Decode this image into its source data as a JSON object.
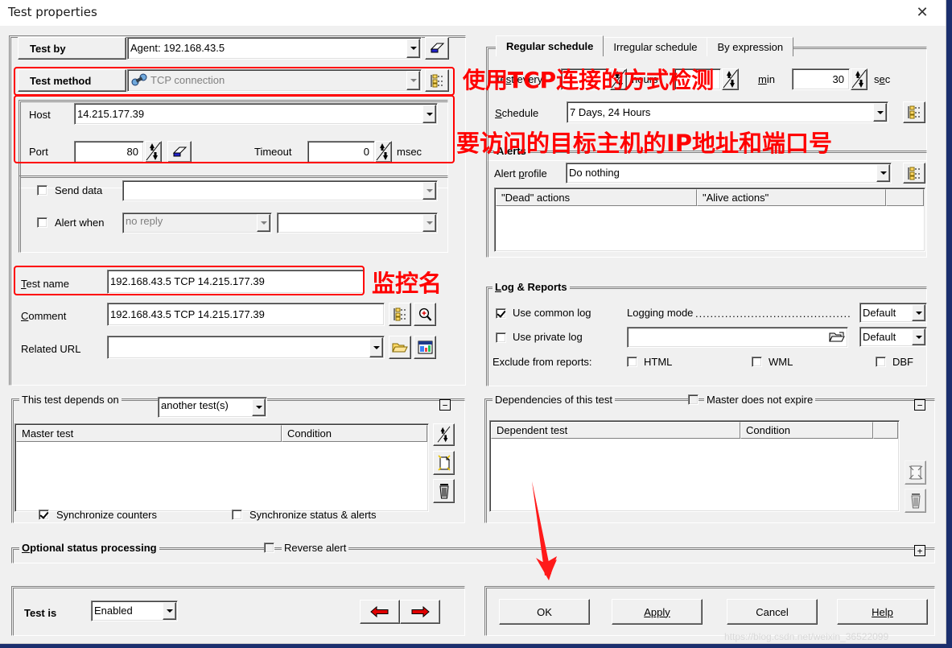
{
  "window": {
    "title": "Test properties",
    "close_label": "✕"
  },
  "left": {
    "test_by": {
      "label": "Test by",
      "value": "Agent: 192.168.43.5"
    },
    "test_method": {
      "label": "Test method",
      "value": "TCP connection"
    },
    "host": {
      "label": "Host",
      "value": "14.215.177.39"
    },
    "port": {
      "label": "Port",
      "value": "80"
    },
    "timeout": {
      "label": "Timeout",
      "value": "0",
      "unit": "msec"
    },
    "send_data": {
      "label": "Send data",
      "value": "",
      "checked": false
    },
    "alert_when": {
      "label": "Alert when",
      "value": "no reply",
      "value2": "",
      "checked": false
    },
    "test_name": {
      "label": "Test name",
      "value": "192.168.43.5 TCP 14.215.177.39"
    },
    "comment": {
      "label": "Comment",
      "value": "192.168.43.5 TCP 14.215.177.39"
    },
    "related_url": {
      "label": "Related URL",
      "value": ""
    }
  },
  "schedule": {
    "tabs": [
      {
        "label": "Regular schedule",
        "selected": true
      },
      {
        "label": "Irregular schedule",
        "selected": false
      },
      {
        "label": "By expression",
        "selected": false
      }
    ],
    "test_every": {
      "label": "Test every",
      "hours_value": "",
      "hours_label": "hours",
      "min_value": "",
      "min_label": "min",
      "sec_value": "30",
      "sec_label": "sec"
    },
    "schedule_row": {
      "label": "Schedule",
      "value": "7 Days, 24 Hours"
    }
  },
  "alerts": {
    "legend": "Alerts",
    "alert_profile": {
      "label": "Alert profile",
      "value": "Do nothing"
    },
    "columns": [
      "\"Dead\" actions",
      "\"Alive actions\""
    ],
    "rows": []
  },
  "logs": {
    "legend": "Log & Reports",
    "use_common_log": {
      "label": "Use common log",
      "checked": true
    },
    "use_private_log": {
      "label": "Use private log",
      "checked": false,
      "value": ""
    },
    "logging_mode": {
      "label": "Logging mode",
      "dots": "..........................................",
      "value": "Default"
    },
    "private_log_mode": {
      "value": "Default"
    },
    "exclude_label": "Exclude from reports:",
    "exclude": [
      {
        "label": "HTML",
        "checked": false
      },
      {
        "label": "WML",
        "checked": false
      },
      {
        "label": "DBF",
        "checked": false
      }
    ]
  },
  "depends_on": {
    "legend": "This test depends on",
    "selector": "another test(s)",
    "columns": [
      "Master test",
      "Condition"
    ],
    "rows": [],
    "sync_counters": {
      "label": "Synchronize counters",
      "checked": true
    },
    "sync_status": {
      "label": "Synchronize status & alerts",
      "checked": false
    },
    "collapse": "−"
  },
  "dependencies": {
    "legend": "Dependencies of this test",
    "master_does_not_expire": {
      "label": "Master does not expire",
      "checked": false
    },
    "columns": [
      "Dependent test",
      "Condition"
    ],
    "rows": [],
    "collapse": "−"
  },
  "optional": {
    "legend": "Optional status processing",
    "reverse_alert": {
      "label": "Reverse alert",
      "checked": false
    },
    "expand": "+"
  },
  "footer": {
    "test_is_label": "Test is",
    "test_is_value": "Enabled",
    "prev_icon": "left-arrow-icon",
    "next_icon": "right-arrow-icon",
    "buttons": [
      {
        "label": "OK",
        "name": "ok-button"
      },
      {
        "label": "Apply",
        "name": "apply-button"
      },
      {
        "label": "Cancel",
        "name": "cancel-button"
      },
      {
        "label": "Help",
        "name": "help-button"
      }
    ]
  },
  "annotations": [
    {
      "text": "使用TCP连接的方式检测"
    },
    {
      "text": "要访问的目标主机的IP地址和端口号"
    },
    {
      "text": "监控名"
    }
  ],
  "watermark": "https://blog.csdn.net/weixin_36522099",
  "colors": {
    "annotation": "#ff0000",
    "dialog": "#f0f0f0",
    "desktop": "#1b2f6e"
  }
}
